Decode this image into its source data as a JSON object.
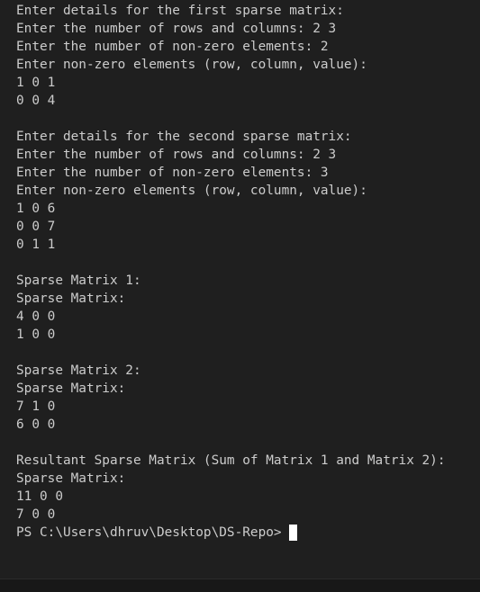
{
  "terminal": {
    "lines": [
      "Enter details for the first sparse matrix:",
      "Enter the number of rows and columns: 2 3",
      "Enter the number of non-zero elements: 2",
      "Enter non-zero elements (row, column, value):",
      "1 0 1",
      "0 0 4",
      "",
      "Enter details for the second sparse matrix:",
      "Enter the number of rows and columns: 2 3",
      "Enter the number of non-zero elements: 3",
      "Enter non-zero elements (row, column, value):",
      "1 0 6",
      "0 0 7",
      "0 1 1",
      "",
      "Sparse Matrix 1:",
      "Sparse Matrix:",
      "4 0 0",
      "1 0 0",
      "",
      "Sparse Matrix 2:",
      "Sparse Matrix:",
      "7 1 0",
      "6 0 0",
      "",
      "Resultant Sparse Matrix (Sum of Matrix 1 and Matrix 2):",
      "Sparse Matrix:",
      "11 0 0",
      "7 0 0"
    ],
    "prompt": "PS C:\\Users\\dhruv\\Desktop\\DS-Repo> "
  },
  "colors": {
    "background": "#1f1f1f",
    "text": "#cccccc",
    "cursor": "#ffffff"
  }
}
